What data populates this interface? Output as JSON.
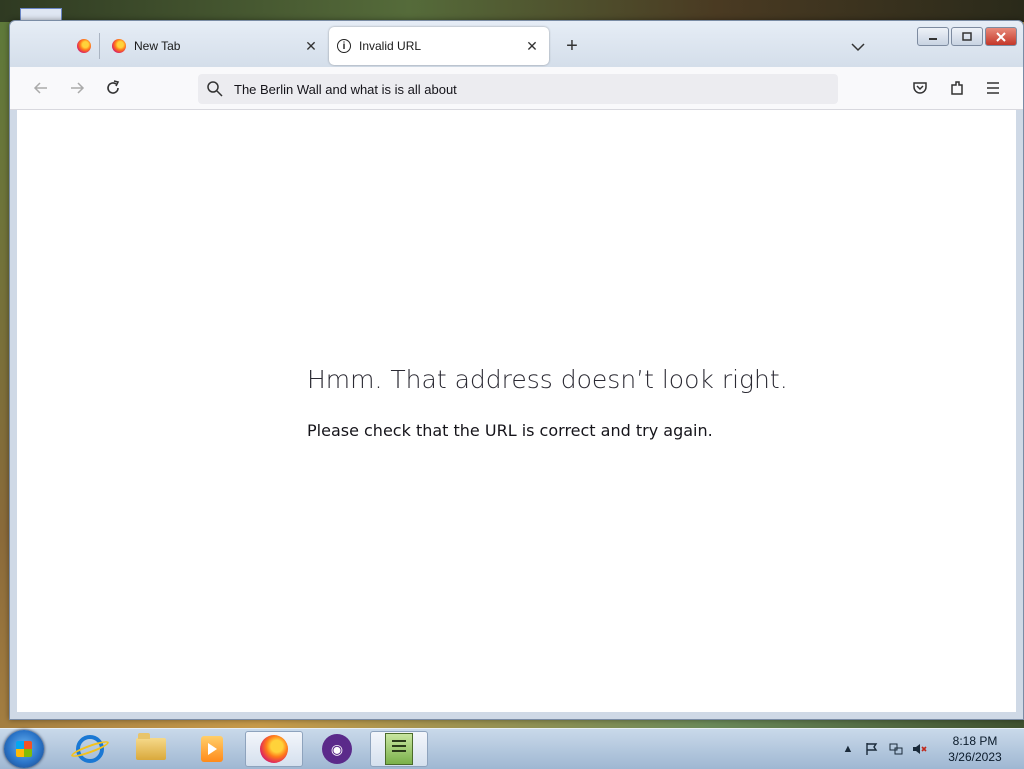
{
  "browser": {
    "tabs": [
      {
        "label": "",
        "icon": "firefox-icon",
        "pinned": true
      },
      {
        "label": "New Tab",
        "icon": "firefox-icon",
        "close": "✕"
      },
      {
        "label": "Invalid URL",
        "icon": "info-icon",
        "close": "✕",
        "active": true
      }
    ],
    "new_tab": "+",
    "url": "The Berlin Wall and what is is all about",
    "page": {
      "title": "Hmm. That address doesn’t look right.",
      "description": "Please check that the URL is correct and try again."
    }
  },
  "taskbar": {
    "time": "8:18 PM",
    "date": "3/26/2023",
    "apps": [
      "internet-explorer",
      "file-explorer",
      "media-player",
      "firefox",
      "privacy-app",
      "notepad-app"
    ]
  }
}
